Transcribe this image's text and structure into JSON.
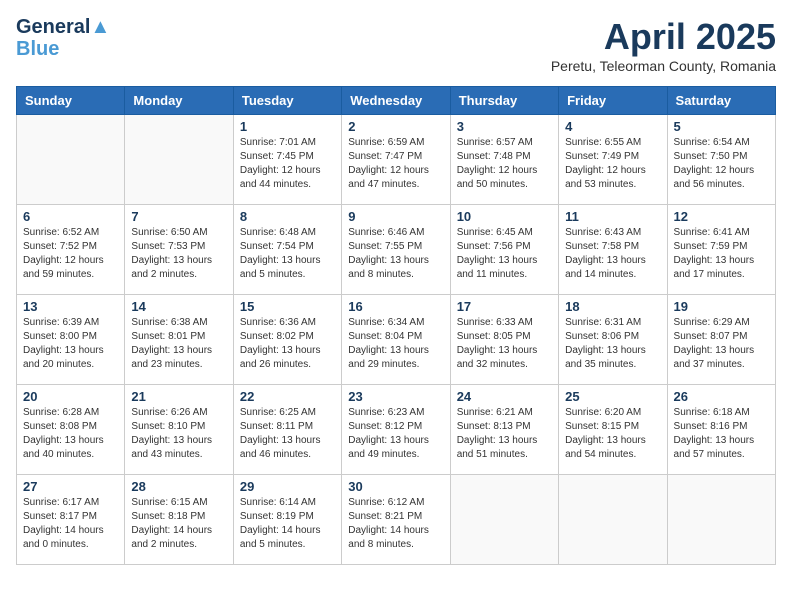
{
  "header": {
    "logo_line1": "General",
    "logo_line2": "Blue",
    "month_year": "April 2025",
    "location": "Peretu, Teleorman County, Romania"
  },
  "weekdays": [
    "Sunday",
    "Monday",
    "Tuesday",
    "Wednesday",
    "Thursday",
    "Friday",
    "Saturday"
  ],
  "weeks": [
    [
      {
        "day": "",
        "info": ""
      },
      {
        "day": "",
        "info": ""
      },
      {
        "day": "1",
        "info": "Sunrise: 7:01 AM\nSunset: 7:45 PM\nDaylight: 12 hours\nand 44 minutes."
      },
      {
        "day": "2",
        "info": "Sunrise: 6:59 AM\nSunset: 7:47 PM\nDaylight: 12 hours\nand 47 minutes."
      },
      {
        "day": "3",
        "info": "Sunrise: 6:57 AM\nSunset: 7:48 PM\nDaylight: 12 hours\nand 50 minutes."
      },
      {
        "day": "4",
        "info": "Sunrise: 6:55 AM\nSunset: 7:49 PM\nDaylight: 12 hours\nand 53 minutes."
      },
      {
        "day": "5",
        "info": "Sunrise: 6:54 AM\nSunset: 7:50 PM\nDaylight: 12 hours\nand 56 minutes."
      }
    ],
    [
      {
        "day": "6",
        "info": "Sunrise: 6:52 AM\nSunset: 7:52 PM\nDaylight: 12 hours\nand 59 minutes."
      },
      {
        "day": "7",
        "info": "Sunrise: 6:50 AM\nSunset: 7:53 PM\nDaylight: 13 hours\nand 2 minutes."
      },
      {
        "day": "8",
        "info": "Sunrise: 6:48 AM\nSunset: 7:54 PM\nDaylight: 13 hours\nand 5 minutes."
      },
      {
        "day": "9",
        "info": "Sunrise: 6:46 AM\nSunset: 7:55 PM\nDaylight: 13 hours\nand 8 minutes."
      },
      {
        "day": "10",
        "info": "Sunrise: 6:45 AM\nSunset: 7:56 PM\nDaylight: 13 hours\nand 11 minutes."
      },
      {
        "day": "11",
        "info": "Sunrise: 6:43 AM\nSunset: 7:58 PM\nDaylight: 13 hours\nand 14 minutes."
      },
      {
        "day": "12",
        "info": "Sunrise: 6:41 AM\nSunset: 7:59 PM\nDaylight: 13 hours\nand 17 minutes."
      }
    ],
    [
      {
        "day": "13",
        "info": "Sunrise: 6:39 AM\nSunset: 8:00 PM\nDaylight: 13 hours\nand 20 minutes."
      },
      {
        "day": "14",
        "info": "Sunrise: 6:38 AM\nSunset: 8:01 PM\nDaylight: 13 hours\nand 23 minutes."
      },
      {
        "day": "15",
        "info": "Sunrise: 6:36 AM\nSunset: 8:02 PM\nDaylight: 13 hours\nand 26 minutes."
      },
      {
        "day": "16",
        "info": "Sunrise: 6:34 AM\nSunset: 8:04 PM\nDaylight: 13 hours\nand 29 minutes."
      },
      {
        "day": "17",
        "info": "Sunrise: 6:33 AM\nSunset: 8:05 PM\nDaylight: 13 hours\nand 32 minutes."
      },
      {
        "day": "18",
        "info": "Sunrise: 6:31 AM\nSunset: 8:06 PM\nDaylight: 13 hours\nand 35 minutes."
      },
      {
        "day": "19",
        "info": "Sunrise: 6:29 AM\nSunset: 8:07 PM\nDaylight: 13 hours\nand 37 minutes."
      }
    ],
    [
      {
        "day": "20",
        "info": "Sunrise: 6:28 AM\nSunset: 8:08 PM\nDaylight: 13 hours\nand 40 minutes."
      },
      {
        "day": "21",
        "info": "Sunrise: 6:26 AM\nSunset: 8:10 PM\nDaylight: 13 hours\nand 43 minutes."
      },
      {
        "day": "22",
        "info": "Sunrise: 6:25 AM\nSunset: 8:11 PM\nDaylight: 13 hours\nand 46 minutes."
      },
      {
        "day": "23",
        "info": "Sunrise: 6:23 AM\nSunset: 8:12 PM\nDaylight: 13 hours\nand 49 minutes."
      },
      {
        "day": "24",
        "info": "Sunrise: 6:21 AM\nSunset: 8:13 PM\nDaylight: 13 hours\nand 51 minutes."
      },
      {
        "day": "25",
        "info": "Sunrise: 6:20 AM\nSunset: 8:15 PM\nDaylight: 13 hours\nand 54 minutes."
      },
      {
        "day": "26",
        "info": "Sunrise: 6:18 AM\nSunset: 8:16 PM\nDaylight: 13 hours\nand 57 minutes."
      }
    ],
    [
      {
        "day": "27",
        "info": "Sunrise: 6:17 AM\nSunset: 8:17 PM\nDaylight: 14 hours\nand 0 minutes."
      },
      {
        "day": "28",
        "info": "Sunrise: 6:15 AM\nSunset: 8:18 PM\nDaylight: 14 hours\nand 2 minutes."
      },
      {
        "day": "29",
        "info": "Sunrise: 6:14 AM\nSunset: 8:19 PM\nDaylight: 14 hours\nand 5 minutes."
      },
      {
        "day": "30",
        "info": "Sunrise: 6:12 AM\nSunset: 8:21 PM\nDaylight: 14 hours\nand 8 minutes."
      },
      {
        "day": "",
        "info": ""
      },
      {
        "day": "",
        "info": ""
      },
      {
        "day": "",
        "info": ""
      }
    ]
  ]
}
